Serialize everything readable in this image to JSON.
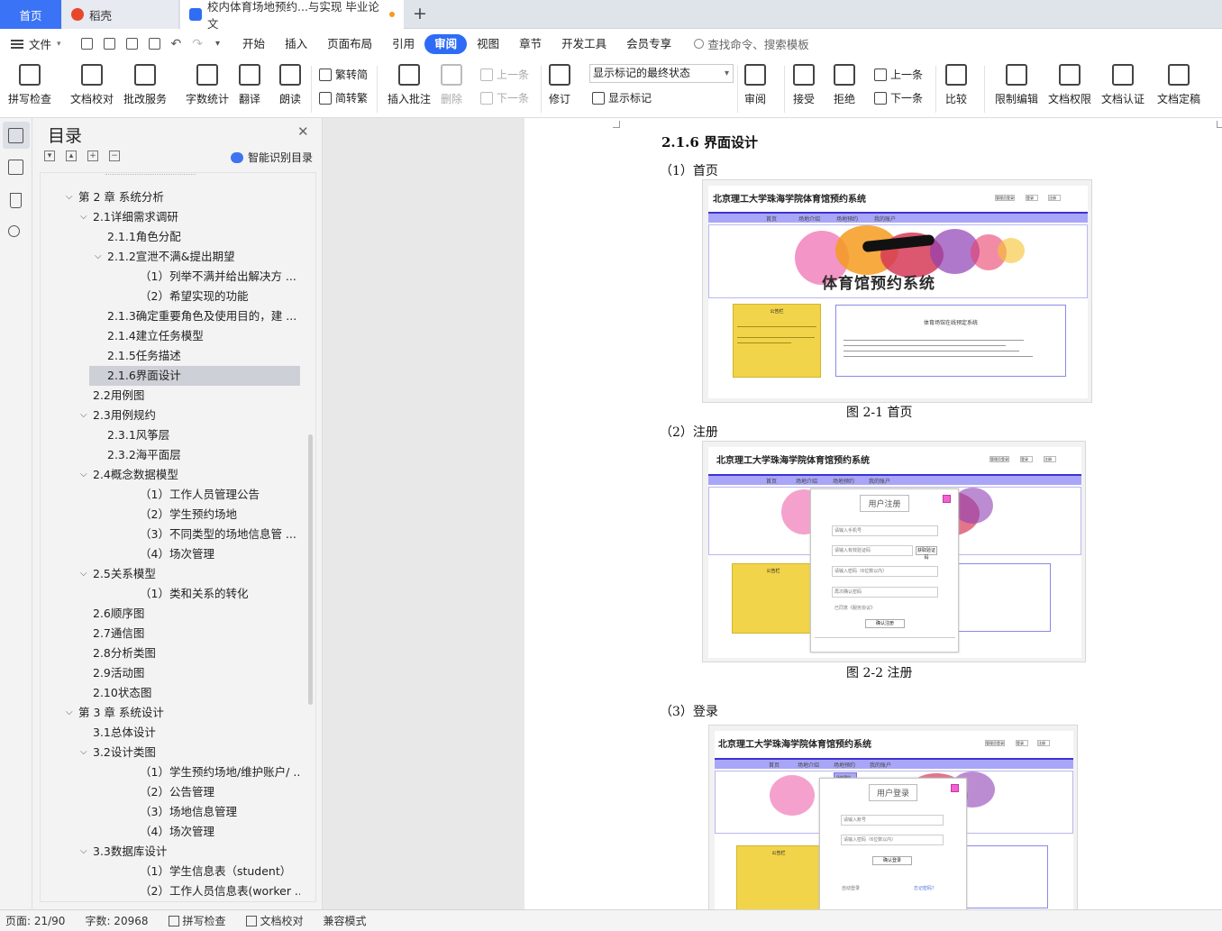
{
  "tabs": {
    "home": "首页",
    "daoke": "稻壳",
    "doc": "校内体育场地预约...与实现 毕业论文",
    "add": "+"
  },
  "menu": {
    "file": "文件",
    "items": [
      "开始",
      "插入",
      "页面布局",
      "引用",
      "审阅",
      "视图",
      "章节",
      "开发工具",
      "会员专享"
    ],
    "active_index": 4,
    "search": "查找命令、搜索模板"
  },
  "ribbon": {
    "spell": "拼写检查",
    "proof": "文档校对",
    "annotate": "批改服务",
    "wordcount": "字数统计",
    "translate": "翻译",
    "read": "朗读",
    "trad": "繁转简",
    "simp": "简转繁",
    "insert_comment": "插入批注",
    "delete": "删除",
    "prev_comment": "上一条",
    "next_comment": "下一条",
    "revise": "修订",
    "display_state": "显示标记的最终状态",
    "show_marks": "显示标记",
    "review": "审阅",
    "accept": "接受",
    "reject": "拒绝",
    "prev": "上一条",
    "next": "下一条",
    "compare": "比较",
    "restrict": "限制编辑",
    "permission": "文档权限",
    "certify": "文档认证",
    "finalize": "文档定稿"
  },
  "toc": {
    "title": "目录",
    "smart": "智能识别目录",
    "items": [
      {
        "text": "第 2 章 系统分析",
        "level": 0,
        "expanded": true
      },
      {
        "text": "2.1详细需求调研",
        "level": 1,
        "expanded": true
      },
      {
        "text": "2.1.1角色分配",
        "level": 2
      },
      {
        "text": "2.1.2宣泄不满&提出期望",
        "level": 2,
        "expanded": true
      },
      {
        "text": "（1）列举不满并给出解决方 ...",
        "level": 3
      },
      {
        "text": "（2）希望实现的功能",
        "level": 3
      },
      {
        "text": "2.1.3确定重要角色及使用目的，建 ...",
        "level": 2
      },
      {
        "text": "2.1.4建立任务模型",
        "level": 2
      },
      {
        "text": "2.1.5任务描述",
        "level": 2
      },
      {
        "text": "2.1.6界面设计",
        "level": 2,
        "selected": true
      },
      {
        "text": "2.2用例图",
        "level": 1
      },
      {
        "text": "2.3用例规约",
        "level": 1,
        "expanded": true
      },
      {
        "text": "2.3.1风筝层",
        "level": 2
      },
      {
        "text": "2.3.2海平面层",
        "level": 2
      },
      {
        "text": "2.4概念数据模型",
        "level": 1,
        "expanded": true
      },
      {
        "text": "（1）工作人员管理公告",
        "level": 3
      },
      {
        "text": "（2）学生预约场地",
        "level": 3
      },
      {
        "text": "（3）不同类型的场地信息管 ...",
        "level": 3
      },
      {
        "text": "（4）场次管理",
        "level": 3
      },
      {
        "text": "2.5关系模型",
        "level": 1,
        "expanded": true
      },
      {
        "text": "（1）类和关系的转化",
        "level": 3
      },
      {
        "text": "2.6顺序图",
        "level": 1
      },
      {
        "text": "2.7通信图",
        "level": 1
      },
      {
        "text": "2.8分析类图",
        "level": 1
      },
      {
        "text": "2.9活动图",
        "level": 1
      },
      {
        "text": "2.10状态图",
        "level": 1
      },
      {
        "text": "第 3 章 系统设计",
        "level": 0,
        "expanded": true
      },
      {
        "text": "3.1总体设计",
        "level": 1
      },
      {
        "text": "3.2设计类图",
        "level": 1,
        "expanded": true
      },
      {
        "text": "（1）学生预约场地/维护账户/ ...",
        "level": 3
      },
      {
        "text": "（2）公告管理",
        "level": 3
      },
      {
        "text": "（3）场地信息管理",
        "level": 3
      },
      {
        "text": "（4）场次管理",
        "level": 3
      },
      {
        "text": "3.3数据库设计",
        "level": 1,
        "expanded": true
      },
      {
        "text": "（1）学生信息表（student）",
        "level": 3
      },
      {
        "text": "（2）工作人员信息表(worker ...",
        "level": 3
      }
    ]
  },
  "doc": {
    "heading": "2.1.6 界面设计",
    "s1": "（1）首页",
    "cap1": "图 2-1   首页",
    "s2": "（2）注册",
    "cap2": "图 2-2   注册",
    "s3": "（3）登录",
    "mock_title": "北京理工大学珠海学院体育馆预约系统",
    "nav": [
      "首页",
      "场地介绍",
      "场地预约",
      "我的账户"
    ],
    "banner_text": "体育馆预约系统",
    "notice_head": "公告栏",
    "sys_head": "体育场馆在线预定系统",
    "register_title": "用户注册",
    "login_title": "用户登录",
    "reg_fields": [
      "请输入手机号",
      "请输入有效验证码",
      "请输入密码（6位数以内）",
      "再次确认密码"
    ],
    "login_fields": [
      "请输入账号",
      "请输入密码（6位数以内）"
    ],
    "reg_btn": "确认注册",
    "login_btn": "确认登录",
    "sendcode": "获取验证码",
    "agree": "已同意《服务协议》",
    "remember": "自动登录",
    "forgot": "忘记密码？",
    "topbtns": [
      "管理员登录",
      "登录",
      "注册"
    ],
    "dropdown": [
      "场地预约",
      "场地查询",
      "退订场"
    ]
  },
  "status": {
    "page": "页面: 21/90",
    "words": "字数: 20968",
    "spell": "拼写检查",
    "proof": "文档校对",
    "compat": "兼容模式"
  },
  "colors": {
    "accent": "#2e6cf5",
    "nav": "#a9a6f7",
    "notice": "#f1d44a",
    "selected": "#cdd0d6"
  }
}
